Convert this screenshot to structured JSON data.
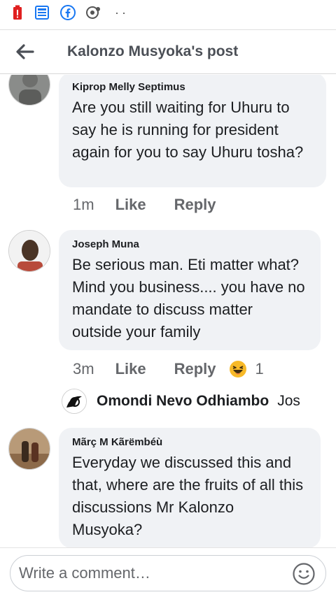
{
  "header": {
    "title": "Kalonzo Musyoka's post"
  },
  "comments": [
    {
      "author": "Kiprop Melly Septimus",
      "text": "Are you still waiting for Uhuru to say he is running for president again for you to say Uhuru tosha?",
      "time": "1m",
      "like_label": "Like",
      "reply_label": "Reply"
    },
    {
      "author": "Joseph Muna",
      "text": "Be serious man. Eti matter what? Mind you business.... you have no mandate to discuss matter outside your family",
      "time": "3m",
      "like_label": "Like",
      "reply_label": "Reply",
      "reaction": {
        "icon": "haha-emoji-icon",
        "count": "1"
      },
      "reply": {
        "author": "Omondi Nevo Odhiambo",
        "preview": "Jos"
      }
    },
    {
      "author": "Mãrç M Kãrëmbéù",
      "text": "Everyday we  discussed this and that, where are the fruits of all this discussions Mr Kalonzo Musyoka?"
    }
  ],
  "composer": {
    "placeholder": "Write a comment…"
  }
}
